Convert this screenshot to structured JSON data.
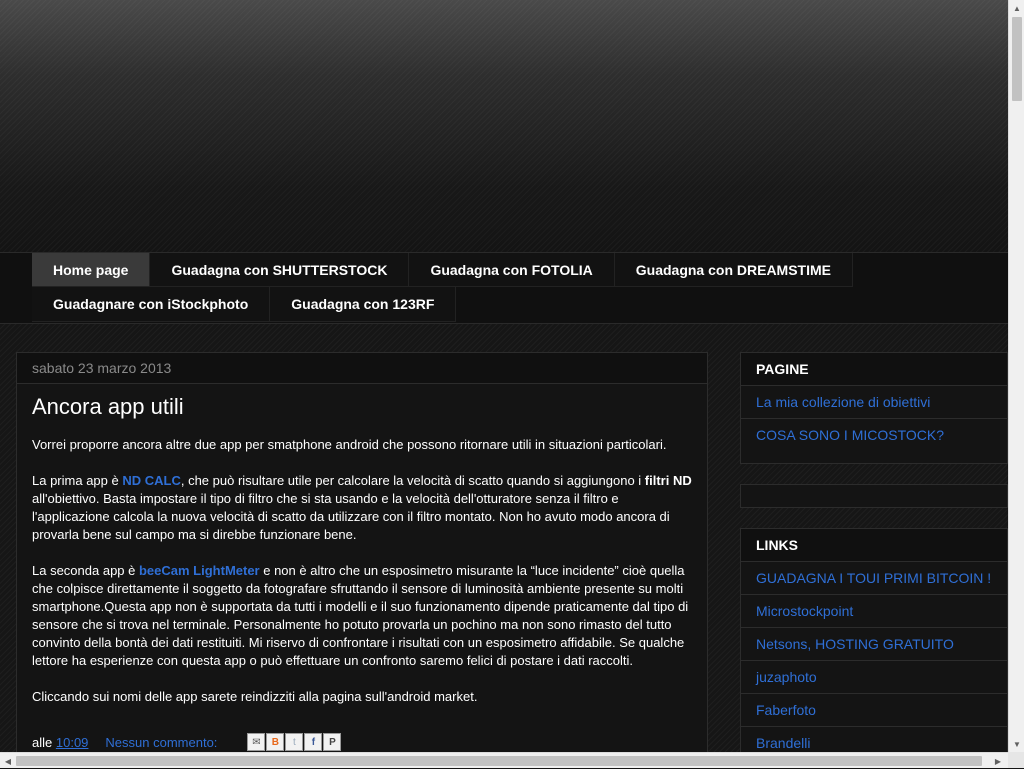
{
  "tabs": [
    [
      "Home page",
      "Guadagna con SHUTTERSTOCK",
      "Guadagna con FOTOLIA",
      "Guadagna con DREAMSTIME"
    ],
    [
      "Guadagnare con iStockphoto",
      "Guadagna con 123RF"
    ]
  ],
  "post": {
    "date": "sabato 23 marzo 2013",
    "title": "Ancora app utili",
    "p1": "Vorrei proporre ancora altre due app per smatphone android che possono ritornare utili in situazioni particolari.",
    "p2_pre": "La prima app è ",
    "p2_link": "ND CALC",
    "p2_mid": ", che può risultare utile per calcolare la velocità di scatto quando si aggiungono i ",
    "p2_bold": "filtri ND",
    "p2_post": " all'obiettivo. Basta impostare il tipo di filtro che si sta usando e la velocità dell'otturatore senza il filtro e l'applicazione calcola la nuova velocità di scatto da utilizzare con il filtro montato. Non ho avuto modo ancora di provarla bene sul campo ma si direbbe funzionare bene.",
    "p3_pre": "La seconda app è ",
    "p3_link": "beeCam LightMeter",
    "p3_post": " e non è altro che un esposimetro misurante la  “luce incidente” cioè quella che colpisce direttamente il soggetto da fotografare sfruttando il sensore di luminosità ambiente presente su molti smartphone.Questa app non è supportata da tutti i modelli e il suo funzionamento dipende praticamente dal tipo di sensore che si trova nel terminale. Personalmente ho potuto provarla un pochino ma non sono rimasto del tutto convinto della bontà dei dati restituiti. Mi riservo di confrontare i risultati con un esposimetro affidabile. Se qualche lettore ha esperienze con questa app o può effettuare un confronto saremo felici di postare i dati raccolti.",
    "p4": "Cliccando sui nomi delle app sarete reindizziti alla pagina sull'android market.",
    "footer_prefix": "alle",
    "time": "10:09",
    "comments": "Nessun commento:"
  },
  "sidebar": {
    "pages_title": "PAGINE",
    "pages": [
      "La mia collezione di obiettivi",
      "COSA SONO I MICOSTOCK?"
    ],
    "links_title": "LINKS",
    "links": [
      "GUADAGNA I TOUI PRIMI BITCOIN !",
      "Microstockpoint",
      "Netsons, HOSTING GRATUITO",
      "juzaphoto",
      "Faberfoto",
      "Brandelli"
    ]
  },
  "share_icons": [
    "email-icon",
    "blogger-icon",
    "twitter-icon",
    "facebook-icon",
    "pinterest-icon"
  ],
  "colors": {
    "link": "#2f6fd6",
    "background": "#161616",
    "active_tab": "#3a3a3a"
  }
}
